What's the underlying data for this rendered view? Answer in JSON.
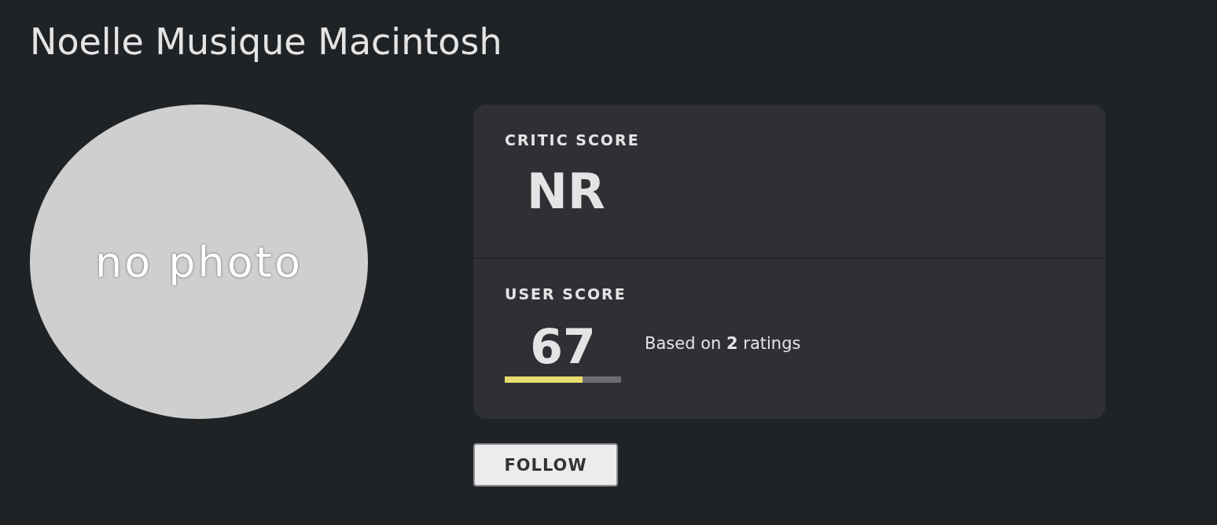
{
  "title": "Noelle Musique Macintosh",
  "photo": {
    "placeholder": "no photo"
  },
  "critic_score": {
    "label": "CRITIC SCORE",
    "value": "NR"
  },
  "user_score": {
    "label": "USER SCORE",
    "value": "67",
    "level": 0.67,
    "note": "Based on **2** ratings"
  },
  "buttons": [
    "FOLLOW"
  ]
}
